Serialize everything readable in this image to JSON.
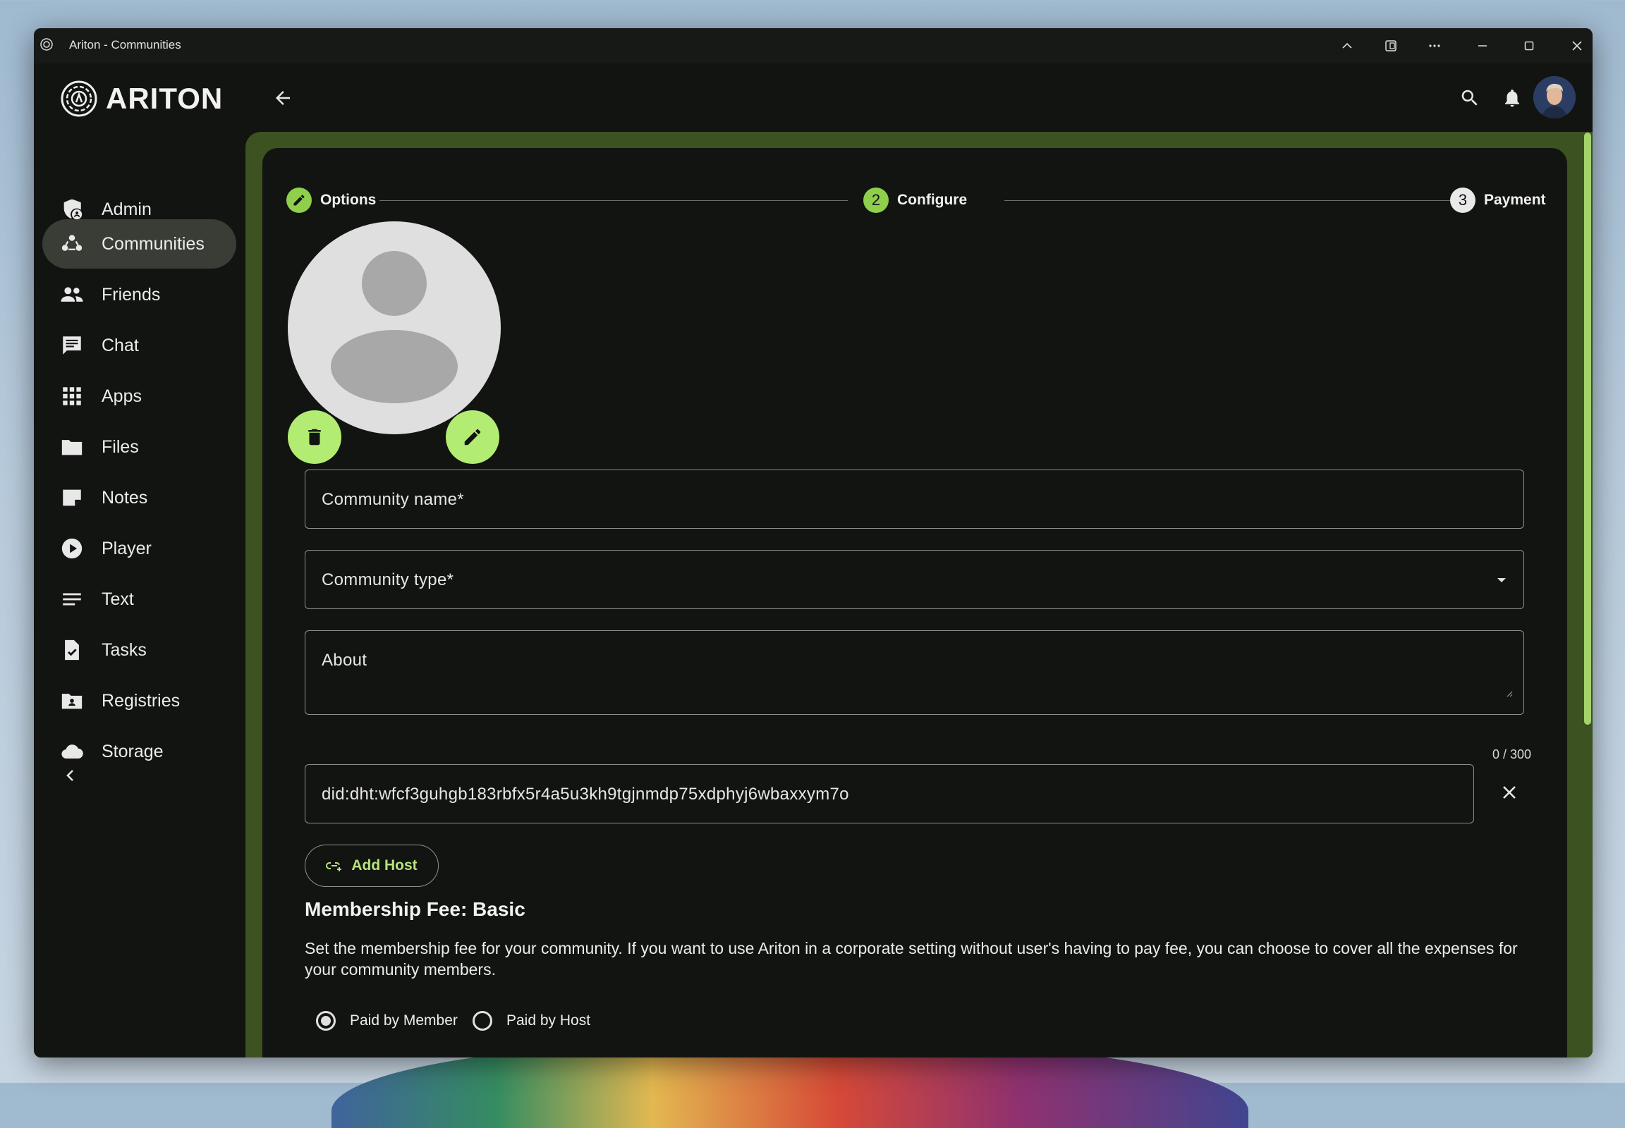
{
  "window": {
    "title": "Ariton - Communities"
  },
  "app": {
    "brand": "ARITON"
  },
  "sidebar": {
    "items": [
      {
        "label": "Admin",
        "icon": "admin-icon",
        "active": false
      },
      {
        "label": "Communities",
        "icon": "communities-icon",
        "active": true
      },
      {
        "label": "Friends",
        "icon": "friends-icon",
        "active": false
      },
      {
        "label": "Chat",
        "icon": "chat-icon",
        "active": false
      },
      {
        "label": "Apps",
        "icon": "apps-grid-icon",
        "active": false
      },
      {
        "label": "Files",
        "icon": "folder-icon",
        "active": false
      },
      {
        "label": "Notes",
        "icon": "note-icon",
        "active": false
      },
      {
        "label": "Player",
        "icon": "play-icon",
        "active": false
      },
      {
        "label": "Text",
        "icon": "text-lines-icon",
        "active": false
      },
      {
        "label": "Tasks",
        "icon": "task-icon",
        "active": false
      },
      {
        "label": "Registries",
        "icon": "registry-icon",
        "active": false
      },
      {
        "label": "Storage",
        "icon": "cloud-icon",
        "active": false
      }
    ]
  },
  "stepper": {
    "steps": [
      {
        "label": "Options",
        "marker": "✎",
        "state": "completed"
      },
      {
        "label": "Configure",
        "marker": "2",
        "state": "active"
      },
      {
        "label": "Payment",
        "marker": "3",
        "state": "pending"
      }
    ]
  },
  "form": {
    "community_name_label": "Community name*",
    "community_type_label": "Community type*",
    "about_label": "About",
    "about_counter": "0 / 300",
    "host_value": "did:dht:wfcf3guhgb183rbfx5r4a5u3kh9tgjnmdp75xdphyj6wbaxxym7o",
    "add_host_label": "Add Host"
  },
  "membership": {
    "title": "Membership Fee: Basic",
    "description": "Set the membership fee for your community. If you want to use Ariton in a corporate setting without user's having to pay fee, you can choose to cover all the expenses for your community members.",
    "options": [
      {
        "label": "Paid by Member",
        "selected": true
      },
      {
        "label": "Paid by Host",
        "selected": false
      }
    ]
  },
  "colors": {
    "accent": "#b3ec73",
    "panel_border": "#3c5221",
    "background": "#121411"
  }
}
